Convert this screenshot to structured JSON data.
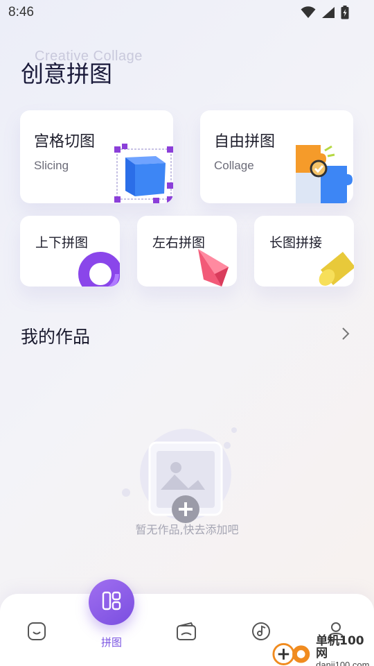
{
  "status_bar": {
    "time": "8:46"
  },
  "header": {
    "watermark": "Creative Collage",
    "title": "创意拼图"
  },
  "feature_cards": [
    {
      "title": "宫格切图",
      "subtitle": "Slicing"
    },
    {
      "title": "自由拼图",
      "subtitle": "Collage"
    }
  ],
  "small_cards": [
    {
      "title": "上下拼图"
    },
    {
      "title": "左右拼图"
    },
    {
      "title": "长图拼接"
    }
  ],
  "works": {
    "title": "我的作品",
    "empty_text": "暂无作品,快去添加吧"
  },
  "tabbar": {
    "active_label": "拼图",
    "tabs": [
      "home-icon",
      "collage-icon",
      "wallet-icon",
      "music-icon",
      "profile-icon"
    ]
  },
  "watermark_logo": {
    "cn": "单机100网",
    "en": "danji100.com"
  },
  "colors": {
    "accent": "#7b55e2",
    "background": "#f1f1f7"
  }
}
